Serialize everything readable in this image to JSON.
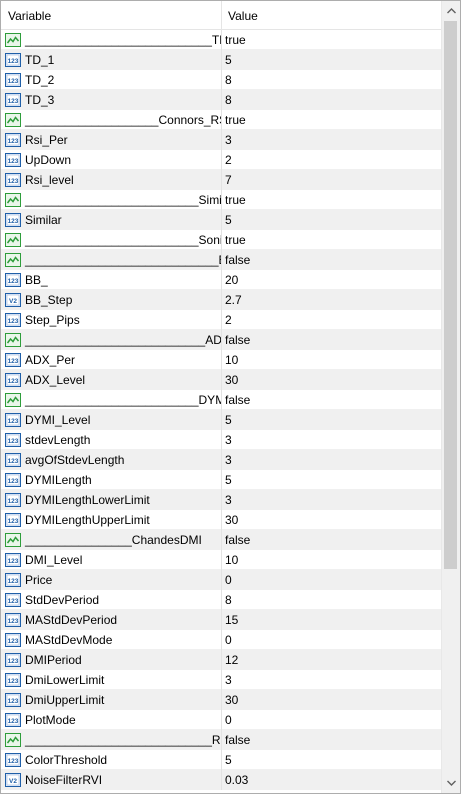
{
  "header": {
    "variable": "Variable",
    "value": "Value"
  },
  "rows": [
    {
      "icon": "boolean-icon",
      "name": "____________________________TD",
      "value": "true"
    },
    {
      "icon": "integer-icon",
      "name": "TD_1",
      "value": "5"
    },
    {
      "icon": "integer-icon",
      "name": "TD_2",
      "value": "8"
    },
    {
      "icon": "integer-icon",
      "name": "TD_3",
      "value": "8"
    },
    {
      "icon": "boolean-icon",
      "name": "____________________Connors_RSI",
      "value": "true"
    },
    {
      "icon": "integer-icon",
      "name": "Rsi_Per",
      "value": "3"
    },
    {
      "icon": "integer-icon",
      "name": "UpDown",
      "value": "2"
    },
    {
      "icon": "integer-icon",
      "name": "Rsi_level",
      "value": "7"
    },
    {
      "icon": "boolean-icon",
      "name": "__________________________Similar",
      "value": "true"
    },
    {
      "icon": "integer-icon",
      "name": "Similar",
      "value": "5"
    },
    {
      "icon": "boolean-icon",
      "name": "__________________________Sonic",
      "value": "true"
    },
    {
      "icon": "boolean-icon",
      "name": "_____________________________BB",
      "value": "false"
    },
    {
      "icon": "integer-icon",
      "name": "BB_",
      "value": "20"
    },
    {
      "icon": "double-icon",
      "name": "BB_Step",
      "value": "2.7"
    },
    {
      "icon": "integer-icon",
      "name": "Step_Pips",
      "value": "2"
    },
    {
      "icon": "boolean-icon",
      "name": "___________________________ADX",
      "value": "false"
    },
    {
      "icon": "integer-icon",
      "name": "ADX_Per",
      "value": "10"
    },
    {
      "icon": "integer-icon",
      "name": "ADX_Level",
      "value": "30"
    },
    {
      "icon": "boolean-icon",
      "name": "__________________________DYMI",
      "value": "false"
    },
    {
      "icon": "integer-icon",
      "name": "DYMI_Level",
      "value": "5"
    },
    {
      "icon": "integer-icon",
      "name": "stdevLength",
      "value": "3"
    },
    {
      "icon": "integer-icon",
      "name": "avgOfStdevLength",
      "value": "3"
    },
    {
      "icon": "integer-icon",
      "name": "DYMILength",
      "value": "5"
    },
    {
      "icon": "integer-icon",
      "name": "DYMILengthLowerLimit",
      "value": "3"
    },
    {
      "icon": "integer-icon",
      "name": "DYMILengthUpperLimit",
      "value": "30"
    },
    {
      "icon": "boolean-icon",
      "name": "________________ChandesDMI",
      "value": "false"
    },
    {
      "icon": "integer-icon",
      "name": "DMI_Level",
      "value": "10"
    },
    {
      "icon": "integer-icon",
      "name": "Price",
      "value": "0"
    },
    {
      "icon": "integer-icon",
      "name": "StdDevPeriod",
      "value": "8"
    },
    {
      "icon": "integer-icon",
      "name": "MAStdDevPeriod",
      "value": "15"
    },
    {
      "icon": "integer-icon",
      "name": "MAStdDevMode",
      "value": "0"
    },
    {
      "icon": "integer-icon",
      "name": "DMIPeriod",
      "value": "12"
    },
    {
      "icon": "integer-icon",
      "name": "DmiLowerLimit",
      "value": "3"
    },
    {
      "icon": "integer-icon",
      "name": "DmiUpperLimit",
      "value": "30"
    },
    {
      "icon": "integer-icon",
      "name": "PlotMode",
      "value": "0"
    },
    {
      "icon": "boolean-icon",
      "name": "____________________________RD",
      "value": "false"
    },
    {
      "icon": "integer-icon",
      "name": "ColorThreshold",
      "value": "5"
    },
    {
      "icon": "double-icon",
      "name": "NoiseFilterRVI",
      "value": "0.03"
    }
  ],
  "colors": {
    "integer_icon": "#1f5fa8",
    "boolean_icon": "#2e9d3b",
    "double_icon": "#1f5fa8"
  }
}
